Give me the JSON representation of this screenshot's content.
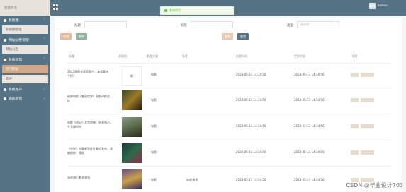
{
  "brand": {
    "title": "后台首页"
  },
  "topbar": {
    "user": "admin"
  },
  "toast": {
    "message": "查询成功"
  },
  "sidebar": {
    "groups": [
      {
        "label": "影视圈",
        "sub": [
          "影视圈管理"
        ]
      },
      {
        "label": "网站公告管理",
        "sub": [
          "网站公告"
        ]
      },
      {
        "label": "影视管理",
        "sub": [
          "热门影视",
          "影评"
        ]
      },
      {
        "label": "系统用户",
        "sub": []
      },
      {
        "label": "通知管理",
        "sub": []
      }
    ]
  },
  "filters": {
    "title_label": "标题",
    "name_label": "标签",
    "type_label": "类型",
    "type_placeholder": "请选择",
    "add_label": "新增",
    "delete_label": "删除",
    "search_label": "查询",
    "reset_label": "重置"
  },
  "table": {
    "headers": [
      "标题",
      "封面图",
      "影视分类",
      "标签",
      "创建时间",
      "更新时间",
      "操作"
    ],
    "rows": [
      {
        "title": "2023奥斯卡获奖影片，来看看这个榜?",
        "category": "电影",
        "tag": "",
        "created": "2023-05-23 14:34:56",
        "updated": "2023-05-23 14:34:56"
      },
      {
        "title": "经典电影《美丽世界》获影评推荐的",
        "category": "电影",
        "tag": "",
        "created": "2023-05-23 14:34:56",
        "updated": "2023-05-23 14:34:56"
      },
      {
        "title": "电影《战火》北京首映，外观独占，冬天最时尚",
        "category": "电影",
        "tag": "",
        "created": "2023-05-23 14:34:56",
        "updated": "2023-05-23 14:34:56"
      },
      {
        "title": "《中秋》的最新宣传片最近发布，超越前作！精彩",
        "category": "电影",
        "tag": "",
        "created": "2023-05-23 14:34:56",
        "updated": "2023-05-23 14:34:56"
      },
      {
        "title": "as的热门影视排行",
        "category": "电影",
        "tag": "as的电影",
        "created": "2023-05-23 14:34:56",
        "updated": "2023-05-23 14:34:56"
      }
    ],
    "actions": {
      "detail": "详情",
      "edit": "修改"
    }
  },
  "watermark": "CSDN @毕业设计703"
}
